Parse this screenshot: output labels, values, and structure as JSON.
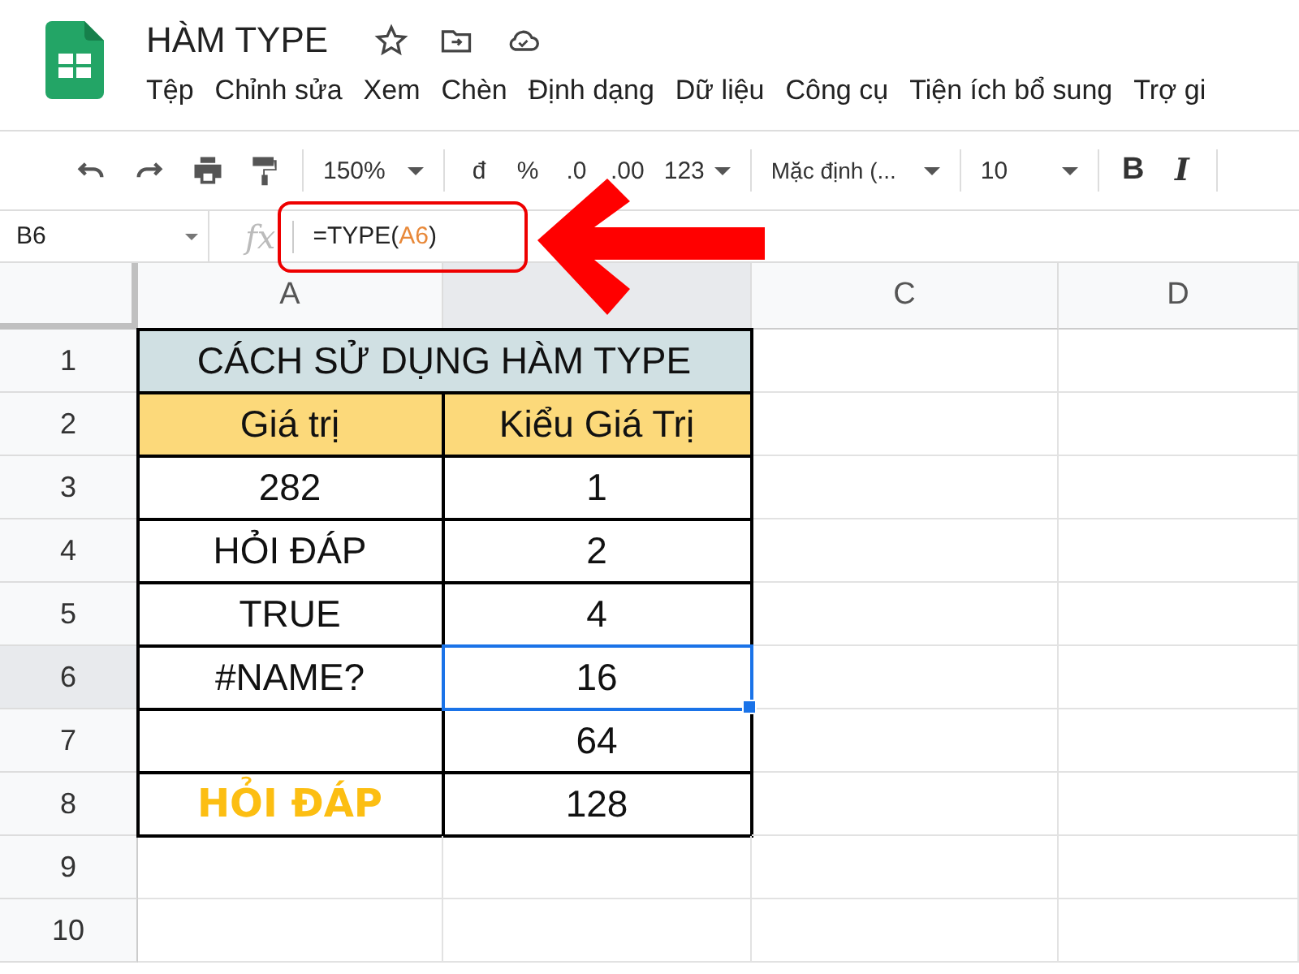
{
  "document": {
    "title": "HÀM TYPE"
  },
  "menu": [
    "Tệp",
    "Chỉnh sửa",
    "Xem",
    "Chèn",
    "Định dạng",
    "Dữ liệu",
    "Công cụ",
    "Tiện ích bổ sung",
    "Trợ gi"
  ],
  "toolbar": {
    "zoom": "150%",
    "format_buttons": [
      "đ",
      "%",
      ".0",
      ".00"
    ],
    "number_format": "123",
    "font": "Mặc định (...",
    "font_size": "10",
    "bold": "B",
    "italic": "I"
  },
  "name_box": "B6",
  "formula_bar": {
    "fx": "fx",
    "parts": [
      {
        "text": "=TYPE(",
        "kind": "plain"
      },
      {
        "text": "A6",
        "kind": "ref"
      },
      {
        "text": ")",
        "kind": "plain"
      }
    ]
  },
  "columns": [
    {
      "label": "A",
      "selected": false
    },
    {
      "selected": true
    },
    {
      "label": "C",
      "selected": false
    },
    {
      "label": "D",
      "selected": false
    }
  ],
  "rows": [
    {
      "number": "1",
      "selected": false,
      "cells": [
        {
          "text": "CÁCH SỬ DỤNG HÀM TYPE",
          "kind": "title",
          "selected": false
        }
      ]
    },
    {
      "number": "2",
      "selected": false,
      "cells": [
        {
          "text": "Giá trị",
          "kind": "header",
          "selected": false
        },
        {
          "text": "Kiểu Giá Trị",
          "kind": "header",
          "selected": false
        }
      ]
    },
    {
      "number": "3",
      "selected": false,
      "cells": [
        {
          "text": "282",
          "kind": "data",
          "selected": false
        },
        {
          "text": "1",
          "kind": "data",
          "selected": false
        }
      ]
    },
    {
      "number": "4",
      "selected": false,
      "cells": [
        {
          "text": "HỎI ĐÁP",
          "kind": "data",
          "selected": false
        },
        {
          "text": "2",
          "kind": "data",
          "selected": false
        }
      ]
    },
    {
      "number": "5",
      "selected": false,
      "cells": [
        {
          "text": "TRUE",
          "kind": "data",
          "selected": false
        },
        {
          "text": "4",
          "kind": "data",
          "selected": false
        }
      ]
    },
    {
      "number": "6",
      "selected": true,
      "cells": [
        {
          "text": "#NAME?",
          "kind": "data",
          "selected": false
        },
        {
          "text": "16",
          "kind": "data",
          "selected": true
        }
      ]
    },
    {
      "number": "7",
      "selected": false,
      "cells": [
        {
          "kind": "data",
          "selected": false
        },
        {
          "text": "64",
          "kind": "data",
          "selected": false
        }
      ]
    },
    {
      "number": "8",
      "selected": false,
      "cells": [
        {
          "text": "HỎI ĐÁP",
          "kind": "logo",
          "selected": false
        },
        {
          "text": "128",
          "kind": "data",
          "selected": false
        }
      ]
    },
    {
      "number": "9",
      "selected": false,
      "cells": []
    },
    {
      "number": "10",
      "selected": false,
      "cells": []
    }
  ]
}
